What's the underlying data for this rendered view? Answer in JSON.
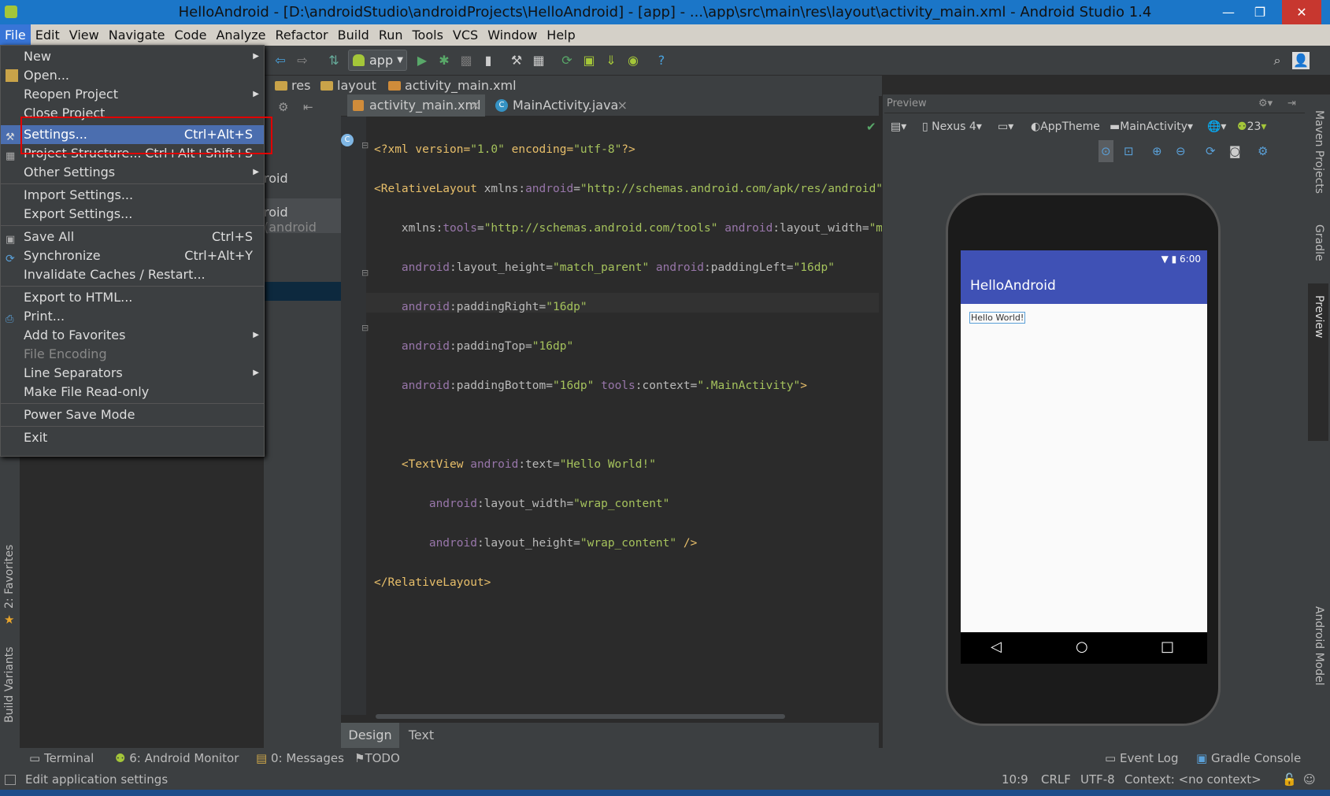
{
  "window": {
    "title": "HelloAndroid - [D:\\androidStudio\\androidProjects\\HelloAndroid] - [app] - ...\\app\\src\\main\\res\\layout\\activity_main.xml - Android Studio 1.4",
    "minimize": "—",
    "maximize": "❐",
    "close": "✕"
  },
  "menubar": [
    "File",
    "Edit",
    "View",
    "Navigate",
    "Code",
    "Analyze",
    "Refactor",
    "Build",
    "Run",
    "Tools",
    "VCS",
    "Window",
    "Help"
  ],
  "toolbar": {
    "run_config": "app"
  },
  "breadcrumb": [
    "res",
    "layout",
    "activity_main.xml"
  ],
  "tabs": [
    {
      "label": "activity_main.xml"
    },
    {
      "label": "MainActivity.java"
    }
  ],
  "project_panel": {
    "row1": "roid",
    "row2": "roid",
    "row2_suffix": "(android"
  },
  "file_menu": {
    "items": [
      {
        "label": "New",
        "submenu": true
      },
      {
        "label": "Open..."
      },
      {
        "label": "Reopen Project",
        "submenu": true
      },
      {
        "label": "Close Project"
      },
      {
        "label": "Settings...",
        "shortcut": "Ctrl+Alt+S"
      },
      {
        "label": "Project Structure...",
        "shortcut": "Ctrl+Alt+Shift+S"
      },
      {
        "label": "Other Settings",
        "submenu": true
      },
      {
        "label": "Import Settings..."
      },
      {
        "label": "Export Settings..."
      },
      {
        "label": "Save All",
        "shortcut": "Ctrl+S"
      },
      {
        "label": "Synchronize",
        "shortcut": "Ctrl+Alt+Y"
      },
      {
        "label": "Invalidate Caches / Restart..."
      },
      {
        "label": "Export to HTML..."
      },
      {
        "label": "Print..."
      },
      {
        "label": "Add to Favorites",
        "submenu": true
      },
      {
        "label": "File Encoding"
      },
      {
        "label": "Line Separators",
        "submenu": true
      },
      {
        "label": "Make File Read-only"
      },
      {
        "label": "Power Save Mode"
      },
      {
        "label": "Exit"
      }
    ]
  },
  "code": {
    "l1": [
      "<?xml version=",
      "\"1.0\"",
      " encoding=",
      "\"utf-8\"",
      "?>"
    ],
    "l2": [
      "<RelativeLayout ",
      "xmlns:",
      "android",
      "=",
      "\"http://schemas.android.com/apk/res/android\""
    ],
    "l3": [
      "    xmlns:",
      "tools",
      "=",
      "\"http://schemas.android.com/tools\"",
      " android",
      ":layout_width=",
      "\"match_p"
    ],
    "l4": [
      "    ",
      "android",
      ":layout_height=",
      "\"match_parent\"",
      " android",
      ":paddingLeft=",
      "\"16dp\""
    ],
    "l5": [
      "    ",
      "android",
      ":paddingRight=",
      "\"16dp\""
    ],
    "l6": [
      "    ",
      "android",
      ":paddingTop=",
      "\"16dp\""
    ],
    "l7": [
      "    ",
      "android",
      ":paddingBottom=",
      "\"16dp\"",
      " tools",
      ":context=",
      "\".MainActivity\"",
      ">"
    ],
    "l9": [
      "    <TextView ",
      "android",
      ":text=",
      "\"Hello World!\""
    ],
    "l10": [
      "        ",
      "android",
      ":layout_width=",
      "\"wrap_content\""
    ],
    "l11": [
      "        ",
      "android",
      ":layout_height=",
      "\"wrap_content\"",
      " />"
    ],
    "l12": [
      "</RelativeLayout>"
    ]
  },
  "editor_bottom_tabs": [
    "Design",
    "Text"
  ],
  "preview": {
    "title": "Preview",
    "device": "Nexus 4",
    "theme": "AppTheme",
    "activity": "MainActivity",
    "api": "23",
    "status_time": "6:00",
    "app_title": "HelloAndroid",
    "hello": "Hello World!"
  },
  "right_strip": [
    "Maven Projects",
    "Gradle",
    "Preview",
    "Android Model"
  ],
  "left_strip": [
    "2: Favorites",
    "Build Variants"
  ],
  "bottom_tools": [
    {
      "label": "Terminal"
    },
    {
      "label": "6: Android Monitor"
    },
    {
      "label": "0: Messages"
    },
    {
      "label": "TODO"
    },
    {
      "label": "Event Log"
    },
    {
      "label": "Gradle Console"
    }
  ],
  "status": {
    "message": "Edit application settings",
    "position": "10:9",
    "line_sep": "CRLF",
    "encoding": "UTF-8",
    "context": "Context: <no context>"
  }
}
